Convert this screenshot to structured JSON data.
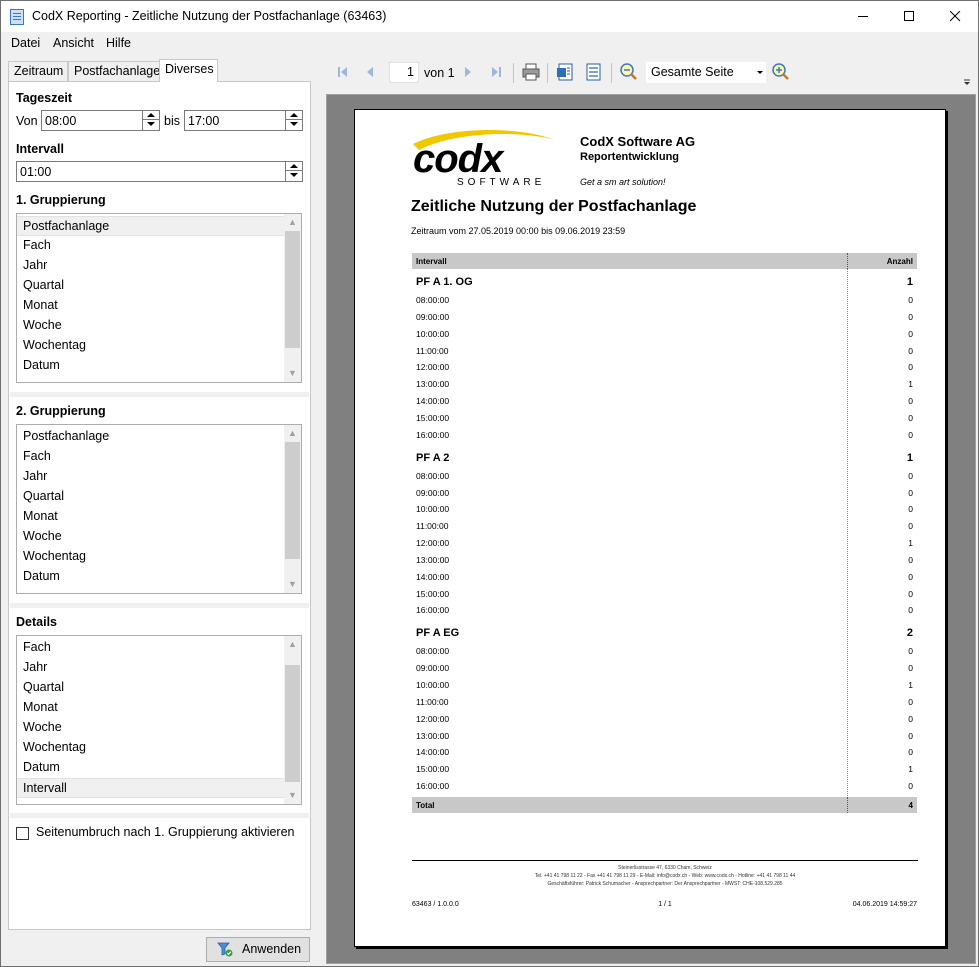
{
  "window": {
    "title": "CodX Reporting - Zeitliche Nutzung der Postfachanlage (63463)",
    "controls": [
      "minimize",
      "maximize",
      "close"
    ]
  },
  "menu": [
    "Datei",
    "Ansicht",
    "Hilfe"
  ],
  "tabs": [
    {
      "label": "Zeitraum",
      "active": false
    },
    {
      "label": "Postfachanlage",
      "active": false
    },
    {
      "label": "Diverses",
      "active": true
    }
  ],
  "panel": {
    "tageszeit": {
      "label": "Tageszeit",
      "von_label": "Von",
      "von_value": "08:00",
      "bis_label": "bis",
      "bis_value": "17:00"
    },
    "intervall": {
      "label": "Intervall",
      "value": "01:00"
    },
    "group1": {
      "label": "1. Gruppierung",
      "items": [
        "Postfachanlage",
        "Fach",
        "Jahr",
        "Quartal",
        "Monat",
        "Woche",
        "Wochentag",
        "Datum"
      ],
      "selected": 0
    },
    "group2": {
      "label": "2. Gruppierung",
      "items": [
        "Postfachanlage",
        "Fach",
        "Jahr",
        "Quartal",
        "Monat",
        "Woche",
        "Wochentag",
        "Datum"
      ],
      "selected": -1
    },
    "details": {
      "label": "Details",
      "items": [
        "Fach",
        "Jahr",
        "Quartal",
        "Monat",
        "Woche",
        "Wochentag",
        "Datum",
        "Intervall"
      ],
      "selected": 7
    },
    "pagebreak": {
      "label": "Seitenumbruch nach 1. Gruppierung aktivieren",
      "checked": false
    },
    "apply_label": "Anwenden"
  },
  "toolbar": {
    "page": "1",
    "page_of": "von 1",
    "zoom": "Gesamte Seite",
    "icons": [
      "first-page-icon",
      "prev-page-icon",
      "next-page-icon",
      "last-page-icon",
      "print-icon",
      "export-icon",
      "export-excel-icon",
      "zoom-out-icon",
      "zoom-in-icon"
    ]
  },
  "report": {
    "logo_text": "codx",
    "logo_sub": "SOFTWARE",
    "company": "CodX Software AG",
    "department": "Reportentwicklung",
    "slogan": "Get a sm art solution!",
    "title": "Zeitliche Nutzung der Postfachanlage",
    "period": "Zeitraum vom 27.05.2019 00:00 bis 09.06.2019 23:59",
    "col_interval": "Intervall",
    "col_count": "Anzahl",
    "groups": [
      {
        "name": "PF A 1. OG",
        "total": "1",
        "rows": [
          [
            "08:00:00",
            "0"
          ],
          [
            "09:00:00",
            "0"
          ],
          [
            "10:00:00",
            "0"
          ],
          [
            "11:00:00",
            "0"
          ],
          [
            "12:00:00",
            "0"
          ],
          [
            "13:00:00",
            "1"
          ],
          [
            "14:00:00",
            "0"
          ],
          [
            "15:00:00",
            "0"
          ],
          [
            "16:00:00",
            "0"
          ]
        ]
      },
      {
        "name": "PF A 2",
        "total": "1",
        "rows": [
          [
            "08:00:00",
            "0"
          ],
          [
            "09:00:00",
            "0"
          ],
          [
            "10:00:00",
            "0"
          ],
          [
            "11:00:00",
            "0"
          ],
          [
            "12:00:00",
            "1"
          ],
          [
            "13:00:00",
            "0"
          ],
          [
            "14:00:00",
            "0"
          ],
          [
            "15:00:00",
            "0"
          ],
          [
            "16:00:00",
            "0"
          ]
        ]
      },
      {
        "name": "PF A EG",
        "total": "2",
        "rows": [
          [
            "08:00:00",
            "0"
          ],
          [
            "09:00:00",
            "0"
          ],
          [
            "10:00:00",
            "1"
          ],
          [
            "11:00:00",
            "0"
          ],
          [
            "12:00:00",
            "0"
          ],
          [
            "13:00:00",
            "0"
          ],
          [
            "14:00:00",
            "0"
          ],
          [
            "15:00:00",
            "1"
          ],
          [
            "16:00:00",
            "0"
          ]
        ]
      }
    ],
    "total_label": "Total",
    "total_value": "4",
    "footer_line1": "Steinerlisstrasse 47, 6330 Cham, Schweiz",
    "footer_line2": "Tel. +41 41 798 11 22 - Fax +41 41 798 11 29 - E-Mail: info@codx.ch - Web: www.codx.ch - Hotline: +41 41 798 11 44",
    "footer_line3": "Geschäftsführer: Patrick Schumacher - Ansprechpartner: Der Ansprechpartner - MWST: CHE-108.529.285",
    "report_id": "63463 / 1.0.0.0",
    "page_num": "1 / 1",
    "print_date": "04.06.2019 14:59:27"
  },
  "colors": {
    "accent_yellow": "#f0c800",
    "header_gray": "#c8c8c8",
    "viewer_bg": "#808080"
  }
}
